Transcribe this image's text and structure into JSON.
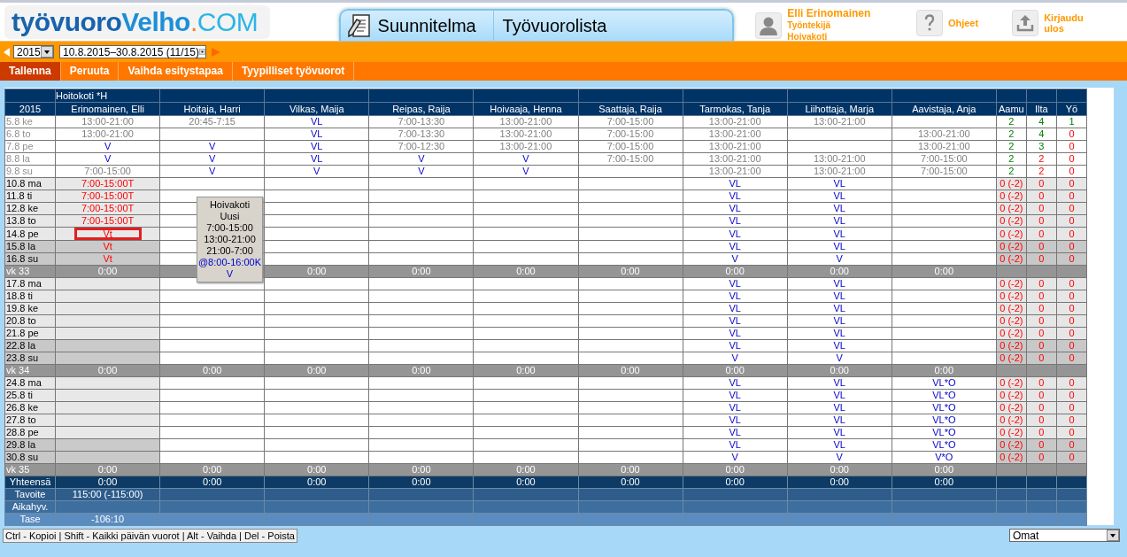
{
  "logo": [
    "työvuoro",
    "Velho",
    ".",
    "COM"
  ],
  "tabs": [
    {
      "label": "Suunnitelma",
      "icon": true
    },
    {
      "label": "Työvuorolista",
      "icon": false
    }
  ],
  "user": {
    "name": "Elli Erinomainen",
    "role": "Työntekijä",
    "unit": "Hoivakoti"
  },
  "header_links": [
    {
      "label": "Ohjeet",
      "kind": "help"
    },
    {
      "label": "Kirjaudu ulos",
      "kind": "logout"
    }
  ],
  "period_bar": {
    "year": "2015",
    "period": "10.8.2015–30.8.2015 (11/15)"
  },
  "menu": [
    {
      "label": "Tallenna",
      "selected": true
    },
    {
      "label": "Peruuta",
      "selected": false
    },
    {
      "label": "Vaihda esitystapaa",
      "selected": false
    },
    {
      "label": "Tyypilliset työvuorot",
      "selected": false
    }
  ],
  "table": {
    "unit": "Hoitokoti *H",
    "year": "2015",
    "columns": [
      {
        "name": "Erinomainen, Elli",
        "own": true
      },
      {
        "name": "Hoitaja, Harri",
        "own": false
      },
      {
        "name": "Vilkas, Maija",
        "own": false
      },
      {
        "name": "Reipas, Raija",
        "own": false
      },
      {
        "name": "Hoivaaja, Henna",
        "own": false
      },
      {
        "name": "Saattaja, Raija",
        "own": false
      },
      {
        "name": "Tarmokas, Tanja",
        "own": false
      },
      {
        "name": "Liihottaja, Marja",
        "own": false
      },
      {
        "name": "Aavistaja, Anja",
        "own": false
      }
    ],
    "counter_columns": [
      "Aamu",
      "Ilta",
      "Yö"
    ],
    "rows": [
      {
        "kind": "past",
        "date": "5.8 ke",
        "cells": [
          {
            "text": "13:00-21:00",
            "kind": "time"
          },
          {
            "text": "20:45-7:15",
            "kind": "time"
          },
          {
            "text": "VL",
            "kind": "absence"
          },
          {
            "text": "7:00-13:30",
            "kind": "time"
          },
          {
            "text": "13:00-21:00",
            "kind": "time"
          },
          {
            "text": "7:00-15:00",
            "kind": "time"
          },
          {
            "text": "13:00-21:00",
            "kind": "time"
          },
          {
            "text": "13:00-21:00",
            "kind": "time"
          },
          null
        ],
        "counters": [
          {
            "text": "2",
            "kind": "met"
          },
          {
            "text": "4",
            "kind": "met"
          },
          {
            "text": "1",
            "kind": "met"
          }
        ]
      },
      {
        "kind": "past",
        "date": "6.8 to",
        "cells": [
          {
            "text": "13:00-21:00",
            "kind": "time"
          },
          null,
          {
            "text": "VL",
            "kind": "absence"
          },
          {
            "text": "7:00-13:30",
            "kind": "time"
          },
          {
            "text": "13:00-21:00",
            "kind": "time"
          },
          {
            "text": "7:00-15:00",
            "kind": "time"
          },
          {
            "text": "13:00-21:00",
            "kind": "time"
          },
          null,
          {
            "text": "13:00-21:00",
            "kind": "time"
          }
        ],
        "counters": [
          {
            "text": "2",
            "kind": "met"
          },
          {
            "text": "4",
            "kind": "met"
          },
          {
            "text": "0",
            "kind": "short"
          }
        ]
      },
      {
        "kind": "past",
        "date": "7.8 pe",
        "cells": [
          {
            "text": "V",
            "kind": "absence"
          },
          {
            "text": "V",
            "kind": "absence"
          },
          {
            "text": "VL",
            "kind": "absence"
          },
          {
            "text": "7:00-12:30",
            "kind": "time"
          },
          {
            "text": "13:00-21:00",
            "kind": "time"
          },
          {
            "text": "7:00-15:00",
            "kind": "time"
          },
          {
            "text": "13:00-21:00",
            "kind": "time"
          },
          null,
          {
            "text": "13:00-21:00",
            "kind": "time"
          }
        ],
        "counters": [
          {
            "text": "2",
            "kind": "met"
          },
          {
            "text": "3",
            "kind": "met"
          },
          {
            "text": "0",
            "kind": "short"
          }
        ]
      },
      {
        "kind": "past",
        "date": "8.8 la",
        "cells": [
          {
            "text": "V",
            "kind": "absence"
          },
          {
            "text": "V",
            "kind": "absence"
          },
          {
            "text": "VL",
            "kind": "absence"
          },
          {
            "text": "V",
            "kind": "absence"
          },
          {
            "text": "V",
            "kind": "absence"
          },
          {
            "text": "7:00-15:00",
            "kind": "time"
          },
          {
            "text": "13:00-21:00",
            "kind": "time"
          },
          {
            "text": "13:00-21:00",
            "kind": "time"
          },
          {
            "text": "7:00-15:00",
            "kind": "time"
          }
        ],
        "counters": [
          {
            "text": "2",
            "kind": "met"
          },
          {
            "text": "2",
            "kind": "short"
          },
          {
            "text": "0",
            "kind": "short"
          }
        ]
      },
      {
        "kind": "past",
        "date": "9.8 su",
        "cells": [
          {
            "text": "7:00-15:00",
            "kind": "time"
          },
          {
            "text": "V",
            "kind": "absence"
          },
          {
            "text": "V",
            "kind": "absence"
          },
          {
            "text": "V",
            "kind": "absence"
          },
          {
            "text": "V",
            "kind": "absence"
          },
          null,
          {
            "text": "13:00-21:00",
            "kind": "time"
          },
          {
            "text": "13:00-21:00",
            "kind": "time"
          },
          {
            "text": "7:00-15:00",
            "kind": "time"
          }
        ],
        "counters": [
          {
            "text": "2",
            "kind": "met"
          },
          {
            "text": "2",
            "kind": "short"
          },
          {
            "text": "0",
            "kind": "short"
          }
        ]
      },
      {
        "kind": "day",
        "date": "10.8 ma",
        "weekend": false,
        "cells": [
          {
            "text": "7:00-15:00T",
            "kind": "planned",
            "selected": false
          },
          null,
          null,
          null,
          null,
          null,
          {
            "text": "VL",
            "kind": "absence",
            "selected": false
          },
          {
            "text": "VL",
            "kind": "absence",
            "selected": false
          },
          null
        ],
        "counters": [
          {
            "text": "0 (-2)",
            "kind": "short"
          },
          {
            "text": "0",
            "kind": "short"
          },
          {
            "text": "0",
            "kind": "short"
          }
        ]
      },
      {
        "kind": "day",
        "date": "11.8 ti",
        "weekend": false,
        "cells": [
          {
            "text": "7:00-15:00T",
            "kind": "planned",
            "selected": false
          },
          null,
          null,
          null,
          null,
          null,
          {
            "text": "VL",
            "kind": "absence",
            "selected": false
          },
          {
            "text": "VL",
            "kind": "absence",
            "selected": false
          },
          null
        ],
        "counters": [
          {
            "text": "0 (-2)",
            "kind": "short"
          },
          {
            "text": "0",
            "kind": "short"
          },
          {
            "text": "0",
            "kind": "short"
          }
        ]
      },
      {
        "kind": "day",
        "date": "12.8 ke",
        "weekend": false,
        "cells": [
          {
            "text": "7:00-15:00T",
            "kind": "planned",
            "selected": false
          },
          null,
          null,
          null,
          null,
          null,
          {
            "text": "VL",
            "kind": "absence",
            "selected": false
          },
          {
            "text": "VL",
            "kind": "absence",
            "selected": false
          },
          null
        ],
        "counters": [
          {
            "text": "0 (-2)",
            "kind": "short"
          },
          {
            "text": "0",
            "kind": "short"
          },
          {
            "text": "0",
            "kind": "short"
          }
        ]
      },
      {
        "kind": "day",
        "date": "13.8 to",
        "weekend": false,
        "cells": [
          {
            "text": "7:00-15:00T",
            "kind": "planned",
            "selected": false
          },
          null,
          null,
          null,
          null,
          null,
          {
            "text": "VL",
            "kind": "absence",
            "selected": false
          },
          {
            "text": "VL",
            "kind": "absence",
            "selected": false
          },
          null
        ],
        "counters": [
          {
            "text": "0 (-2)",
            "kind": "short"
          },
          {
            "text": "0",
            "kind": "short"
          },
          {
            "text": "0",
            "kind": "short"
          }
        ]
      },
      {
        "kind": "day",
        "date": "14.8 pe",
        "weekend": false,
        "cells": [
          {
            "text": "Vt",
            "kind": "planned",
            "selected": true
          },
          null,
          null,
          null,
          null,
          null,
          {
            "text": "VL",
            "kind": "absence",
            "selected": false
          },
          {
            "text": "VL",
            "kind": "absence",
            "selected": false
          },
          null
        ],
        "counters": [
          {
            "text": "0 (-2)",
            "kind": "short"
          },
          {
            "text": "0",
            "kind": "short"
          },
          {
            "text": "0",
            "kind": "short"
          }
        ]
      },
      {
        "kind": "day",
        "date": "15.8 la",
        "weekend": true,
        "cells": [
          {
            "text": "Vt",
            "kind": "planned",
            "selected": false
          },
          null,
          null,
          null,
          null,
          null,
          {
            "text": "VL",
            "kind": "absence",
            "selected": false
          },
          {
            "text": "VL",
            "kind": "absence",
            "selected": false
          },
          null
        ],
        "counters": [
          {
            "text": "0 (-2)",
            "kind": "short"
          },
          {
            "text": "0",
            "kind": "short"
          },
          {
            "text": "0",
            "kind": "short"
          }
        ]
      },
      {
        "kind": "day",
        "date": "16.8 su",
        "weekend": true,
        "cells": [
          {
            "text": "Vt",
            "kind": "planned",
            "selected": false
          },
          null,
          null,
          null,
          null,
          null,
          {
            "text": "V",
            "kind": "absence",
            "selected": false
          },
          {
            "text": "V",
            "kind": "absence",
            "selected": false
          },
          null
        ],
        "counters": [
          {
            "text": "0 (-2)",
            "kind": "short"
          },
          {
            "text": "0",
            "kind": "short"
          },
          {
            "text": "0",
            "kind": "short"
          }
        ]
      },
      {
        "kind": "week",
        "label": "vk 33",
        "cells": [
          "0:00",
          null,
          "0:00",
          "0:00",
          "0:00",
          "0:00",
          "0:00",
          "0:00",
          "0:00"
        ]
      },
      {
        "kind": "day",
        "date": "17.8 ma",
        "weekend": false,
        "cells": [
          null,
          null,
          null,
          null,
          null,
          null,
          {
            "text": "VL",
            "kind": "absence",
            "selected": false
          },
          {
            "text": "VL",
            "kind": "absence",
            "selected": false
          },
          null
        ],
        "counters": [
          {
            "text": "0 (-2)",
            "kind": "short"
          },
          {
            "text": "0",
            "kind": "short"
          },
          {
            "text": "0",
            "kind": "short"
          }
        ]
      },
      {
        "kind": "day",
        "date": "18.8 ti",
        "weekend": false,
        "cells": [
          null,
          null,
          null,
          null,
          null,
          null,
          {
            "text": "VL",
            "kind": "absence",
            "selected": false
          },
          {
            "text": "VL",
            "kind": "absence",
            "selected": false
          },
          null
        ],
        "counters": [
          {
            "text": "0 (-2)",
            "kind": "short"
          },
          {
            "text": "0",
            "kind": "short"
          },
          {
            "text": "0",
            "kind": "short"
          }
        ]
      },
      {
        "kind": "day",
        "date": "19.8 ke",
        "weekend": false,
        "cells": [
          null,
          null,
          null,
          null,
          null,
          null,
          {
            "text": "VL",
            "kind": "absence",
            "selected": false
          },
          {
            "text": "VL",
            "kind": "absence",
            "selected": false
          },
          null
        ],
        "counters": [
          {
            "text": "0 (-2)",
            "kind": "short"
          },
          {
            "text": "0",
            "kind": "short"
          },
          {
            "text": "0",
            "kind": "short"
          }
        ]
      },
      {
        "kind": "day",
        "date": "20.8 to",
        "weekend": false,
        "cells": [
          null,
          null,
          null,
          null,
          null,
          null,
          {
            "text": "VL",
            "kind": "absence",
            "selected": false
          },
          {
            "text": "VL",
            "kind": "absence",
            "selected": false
          },
          null
        ],
        "counters": [
          {
            "text": "0 (-2)",
            "kind": "short"
          },
          {
            "text": "0",
            "kind": "short"
          },
          {
            "text": "0",
            "kind": "short"
          }
        ]
      },
      {
        "kind": "day",
        "date": "21.8 pe",
        "weekend": false,
        "cells": [
          null,
          null,
          null,
          null,
          null,
          null,
          {
            "text": "VL",
            "kind": "absence",
            "selected": false
          },
          {
            "text": "VL",
            "kind": "absence",
            "selected": false
          },
          null
        ],
        "counters": [
          {
            "text": "0 (-2)",
            "kind": "short"
          },
          {
            "text": "0",
            "kind": "short"
          },
          {
            "text": "0",
            "kind": "short"
          }
        ]
      },
      {
        "kind": "day",
        "date": "22.8 la",
        "weekend": true,
        "cells": [
          null,
          null,
          null,
          null,
          null,
          null,
          {
            "text": "VL",
            "kind": "absence",
            "selected": false
          },
          {
            "text": "VL",
            "kind": "absence",
            "selected": false
          },
          null
        ],
        "counters": [
          {
            "text": "0 (-2)",
            "kind": "short"
          },
          {
            "text": "0",
            "kind": "short"
          },
          {
            "text": "0",
            "kind": "short"
          }
        ]
      },
      {
        "kind": "day",
        "date": "23.8 su",
        "weekend": true,
        "cells": [
          null,
          null,
          null,
          null,
          null,
          null,
          {
            "text": "V",
            "kind": "absence",
            "selected": false
          },
          {
            "text": "V",
            "kind": "absence",
            "selected": false
          },
          null
        ],
        "counters": [
          {
            "text": "0 (-2)",
            "kind": "short"
          },
          {
            "text": "0",
            "kind": "short"
          },
          {
            "text": "0",
            "kind": "short"
          }
        ]
      },
      {
        "kind": "week",
        "label": "vk 34",
        "cells": [
          "0:00",
          "0:00",
          "0:00",
          "0:00",
          "0:00",
          "0:00",
          "0:00",
          "0:00",
          "0:00"
        ]
      },
      {
        "kind": "day",
        "date": "24.8 ma",
        "weekend": false,
        "cells": [
          null,
          null,
          null,
          null,
          null,
          null,
          {
            "text": "VL",
            "kind": "absence",
            "selected": false
          },
          {
            "text": "VL",
            "kind": "absence",
            "selected": false
          },
          {
            "text": "VL*O",
            "kind": "absence",
            "selected": false
          }
        ],
        "counters": [
          {
            "text": "0 (-2)",
            "kind": "short"
          },
          {
            "text": "0",
            "kind": "short"
          },
          {
            "text": "0",
            "kind": "short"
          }
        ]
      },
      {
        "kind": "day",
        "date": "25.8 ti",
        "weekend": false,
        "cells": [
          null,
          null,
          null,
          null,
          null,
          null,
          {
            "text": "VL",
            "kind": "absence",
            "selected": false
          },
          {
            "text": "VL",
            "kind": "absence",
            "selected": false
          },
          {
            "text": "VL*O",
            "kind": "absence",
            "selected": false
          }
        ],
        "counters": [
          {
            "text": "0 (-2)",
            "kind": "short"
          },
          {
            "text": "0",
            "kind": "short"
          },
          {
            "text": "0",
            "kind": "short"
          }
        ]
      },
      {
        "kind": "day",
        "date": "26.8 ke",
        "weekend": false,
        "cells": [
          null,
          null,
          null,
          null,
          null,
          null,
          {
            "text": "VL",
            "kind": "absence",
            "selected": false
          },
          {
            "text": "VL",
            "kind": "absence",
            "selected": false
          },
          {
            "text": "VL*O",
            "kind": "absence",
            "selected": false
          }
        ],
        "counters": [
          {
            "text": "0 (-2)",
            "kind": "short"
          },
          {
            "text": "0",
            "kind": "short"
          },
          {
            "text": "0",
            "kind": "short"
          }
        ]
      },
      {
        "kind": "day",
        "date": "27.8 to",
        "weekend": false,
        "cells": [
          null,
          null,
          null,
          null,
          null,
          null,
          {
            "text": "VL",
            "kind": "absence",
            "selected": false
          },
          {
            "text": "VL",
            "kind": "absence",
            "selected": false
          },
          {
            "text": "VL*O",
            "kind": "absence",
            "selected": false
          }
        ],
        "counters": [
          {
            "text": "0 (-2)",
            "kind": "short"
          },
          {
            "text": "0",
            "kind": "short"
          },
          {
            "text": "0",
            "kind": "short"
          }
        ]
      },
      {
        "kind": "day",
        "date": "28.8 pe",
        "weekend": false,
        "cells": [
          null,
          null,
          null,
          null,
          null,
          null,
          {
            "text": "VL",
            "kind": "absence",
            "selected": false
          },
          {
            "text": "VL",
            "kind": "absence",
            "selected": false
          },
          {
            "text": "VL*O",
            "kind": "absence",
            "selected": false
          }
        ],
        "counters": [
          {
            "text": "0 (-2)",
            "kind": "short"
          },
          {
            "text": "0",
            "kind": "short"
          },
          {
            "text": "0",
            "kind": "short"
          }
        ]
      },
      {
        "kind": "day",
        "date": "29.8 la",
        "weekend": true,
        "cells": [
          null,
          null,
          null,
          null,
          null,
          null,
          {
            "text": "VL",
            "kind": "absence",
            "selected": false
          },
          {
            "text": "VL",
            "kind": "absence",
            "selected": false
          },
          {
            "text": "VL*O",
            "kind": "absence",
            "selected": false
          }
        ],
        "counters": [
          {
            "text": "0 (-2)",
            "kind": "short"
          },
          {
            "text": "0",
            "kind": "short"
          },
          {
            "text": "0",
            "kind": "short"
          }
        ]
      },
      {
        "kind": "day",
        "date": "30.8 su",
        "weekend": true,
        "cells": [
          null,
          null,
          null,
          null,
          null,
          null,
          {
            "text": "V",
            "kind": "absence",
            "selected": false
          },
          {
            "text": "V",
            "kind": "absence",
            "selected": false
          },
          {
            "text": "V*O",
            "kind": "absence",
            "selected": false
          }
        ],
        "counters": [
          {
            "text": "0 (-2)",
            "kind": "short"
          },
          {
            "text": "0",
            "kind": "short"
          },
          {
            "text": "0",
            "kind": "short"
          }
        ]
      },
      {
        "kind": "week",
        "label": "vk 35",
        "cells": [
          "0:00",
          "0:00",
          "0:00",
          "0:00",
          "0:00",
          "0:00",
          "0:00",
          "0:00",
          "0:00"
        ]
      },
      {
        "kind": "total",
        "label": "Yhteensä",
        "cells": [
          "0:00",
          "0:00",
          "0:00",
          "0:00",
          "0:00",
          "0:00",
          "0:00",
          "0:00",
          "0:00"
        ]
      },
      {
        "kind": "target",
        "label": "Tavoite",
        "cells": [
          "115:00 (-115:00)"
        ]
      },
      {
        "kind": "flex",
        "label": "Aikahyv."
      },
      {
        "kind": "balance",
        "label": "Tase",
        "cells": [
          "-106:10"
        ]
      }
    ]
  },
  "tooltip": {
    "lines": [
      {
        "text": "Hoivakoti",
        "kind": "info"
      },
      {
        "text": "Uusi",
        "kind": "info"
      },
      {
        "text": "7:00-15:00",
        "kind": "info"
      },
      {
        "text": "13:00-21:00",
        "kind": "info"
      },
      {
        "text": "21:00-7:00",
        "kind": "info"
      },
      {
        "text": "@8:00-16:00K",
        "kind": "shift"
      },
      {
        "text": "V",
        "kind": "shift"
      }
    ]
  },
  "status_bar": {
    "shortcuts": "Ctrl - Kopioi | Shift - Kaikki päivän vuorot | Alt - Vaihda | Del - Poista",
    "view": "Omat"
  }
}
